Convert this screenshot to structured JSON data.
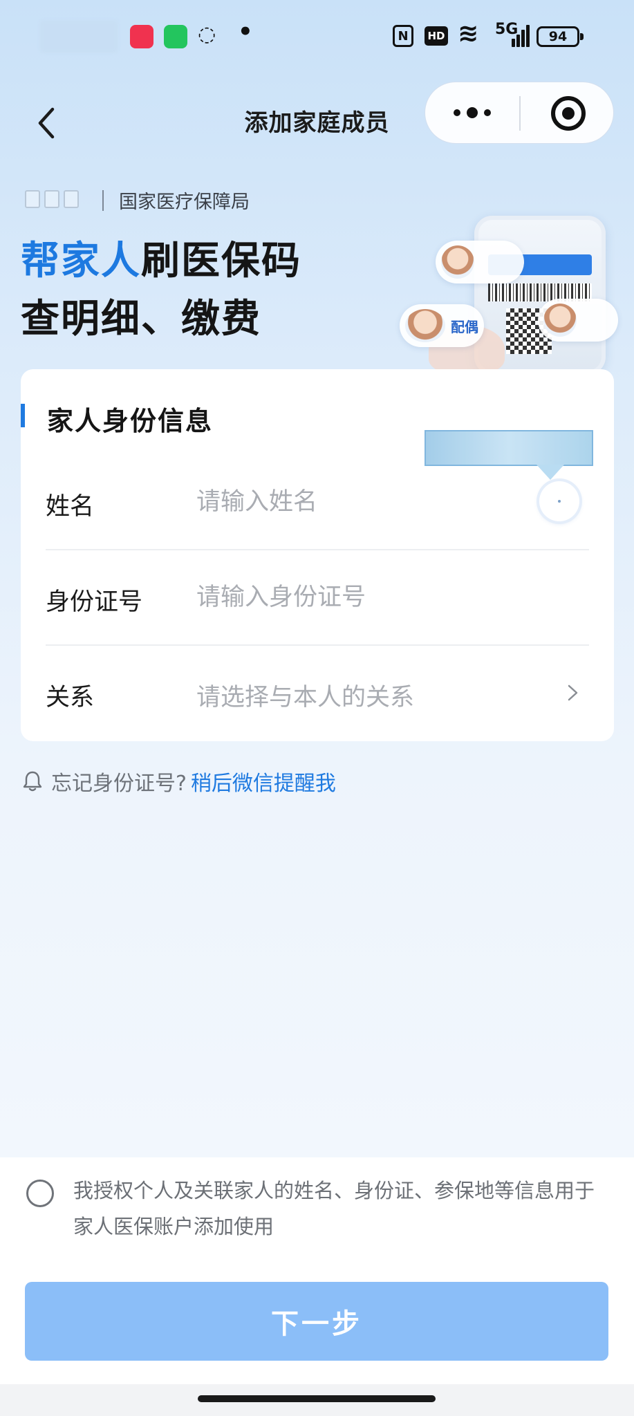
{
  "status_bar": {
    "battery": "94",
    "network": "5G",
    "hd": "HD",
    "nfc": "N"
  },
  "nav": {
    "title": "添加家庭成员"
  },
  "banner": {
    "org_name": "国家医疗保障局",
    "headline_highlight": "帮家人",
    "headline_rest_1": "刷医保码",
    "headline_line_2": "查明细、缴费",
    "spouse_label": "配偶"
  },
  "form": {
    "section_title": "家人身份信息",
    "fields": [
      {
        "label": "姓名",
        "placeholder": "请输入姓名"
      },
      {
        "label": "身份证号",
        "placeholder": "请输入身份证号"
      },
      {
        "label": "关系",
        "placeholder": "请选择与本人的关系"
      }
    ]
  },
  "reminder": {
    "question": "忘记身份证号?",
    "link": "稍后微信提醒我"
  },
  "footer": {
    "consent_text": "我授权个人及关联家人的姓名、身份证、参保地等信息用于家人医保账户添加使用",
    "next_label": "下一步"
  },
  "colors": {
    "accent": "#1f7ae0",
    "button_disabled": "#8bbef8",
    "placeholder": "#a9acb2"
  },
  "icons": [
    "back-arrow-icon",
    "more-dots-icon",
    "close-target-icon",
    "chevron-right-icon",
    "bell-icon",
    "voice-icon"
  ]
}
